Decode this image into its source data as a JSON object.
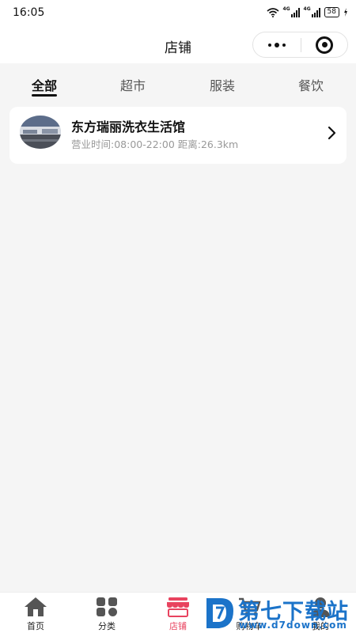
{
  "status_bar": {
    "time": "16:05",
    "signal1": "4G",
    "signal2": "4G",
    "battery": "58"
  },
  "nav": {
    "title": "店铺"
  },
  "tabs": [
    {
      "label": "全部",
      "active": true
    },
    {
      "label": "超市",
      "active": false
    },
    {
      "label": "服装",
      "active": false
    },
    {
      "label": "餐饮",
      "active": false
    }
  ],
  "store": {
    "name": "东方瑞丽洗衣生活馆",
    "hours": "营业时间:08:00-22:00",
    "distance": "距离:26.3km"
  },
  "tabbar": [
    {
      "label": "首页",
      "icon": "home-icon",
      "active": false
    },
    {
      "label": "分类",
      "icon": "category-icon",
      "active": false
    },
    {
      "label": "店铺",
      "icon": "store-icon",
      "active": true
    },
    {
      "label": "购物车",
      "icon": "cart-icon",
      "active": false
    },
    {
      "label": "我的",
      "icon": "user-icon",
      "active": false
    }
  ],
  "watermark": {
    "text": "第七下载站",
    "url": "www.d7down.com"
  },
  "colors": {
    "accent": "#e8435f",
    "watermark": "#1b73c9"
  }
}
